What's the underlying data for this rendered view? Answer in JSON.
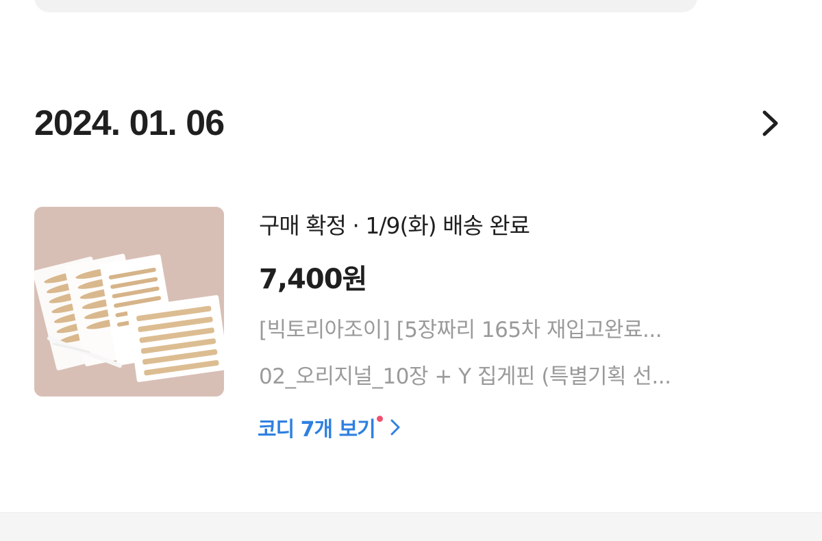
{
  "order": {
    "date": "2024. 01. 06",
    "status": "구매 확정 · 1/9(화) 배송 완료",
    "price": "7,400원",
    "product_name": "[빅토리아조이] [5장짜리 165차 재입고완료...",
    "option": "02_오리지널_10장 + Y 집게핀 (특별기획 선...",
    "coordi_label": "코디 7개 보기"
  },
  "icons": {
    "detail": "chevron-right-icon",
    "coordi": "chevron-right-icon",
    "new_badge": "red-dot"
  },
  "colors": {
    "link": "#2f80e0",
    "new_dot": "#f0506e",
    "muted_text": "#9a9a9a",
    "image_bg": "#d8bfb6"
  }
}
